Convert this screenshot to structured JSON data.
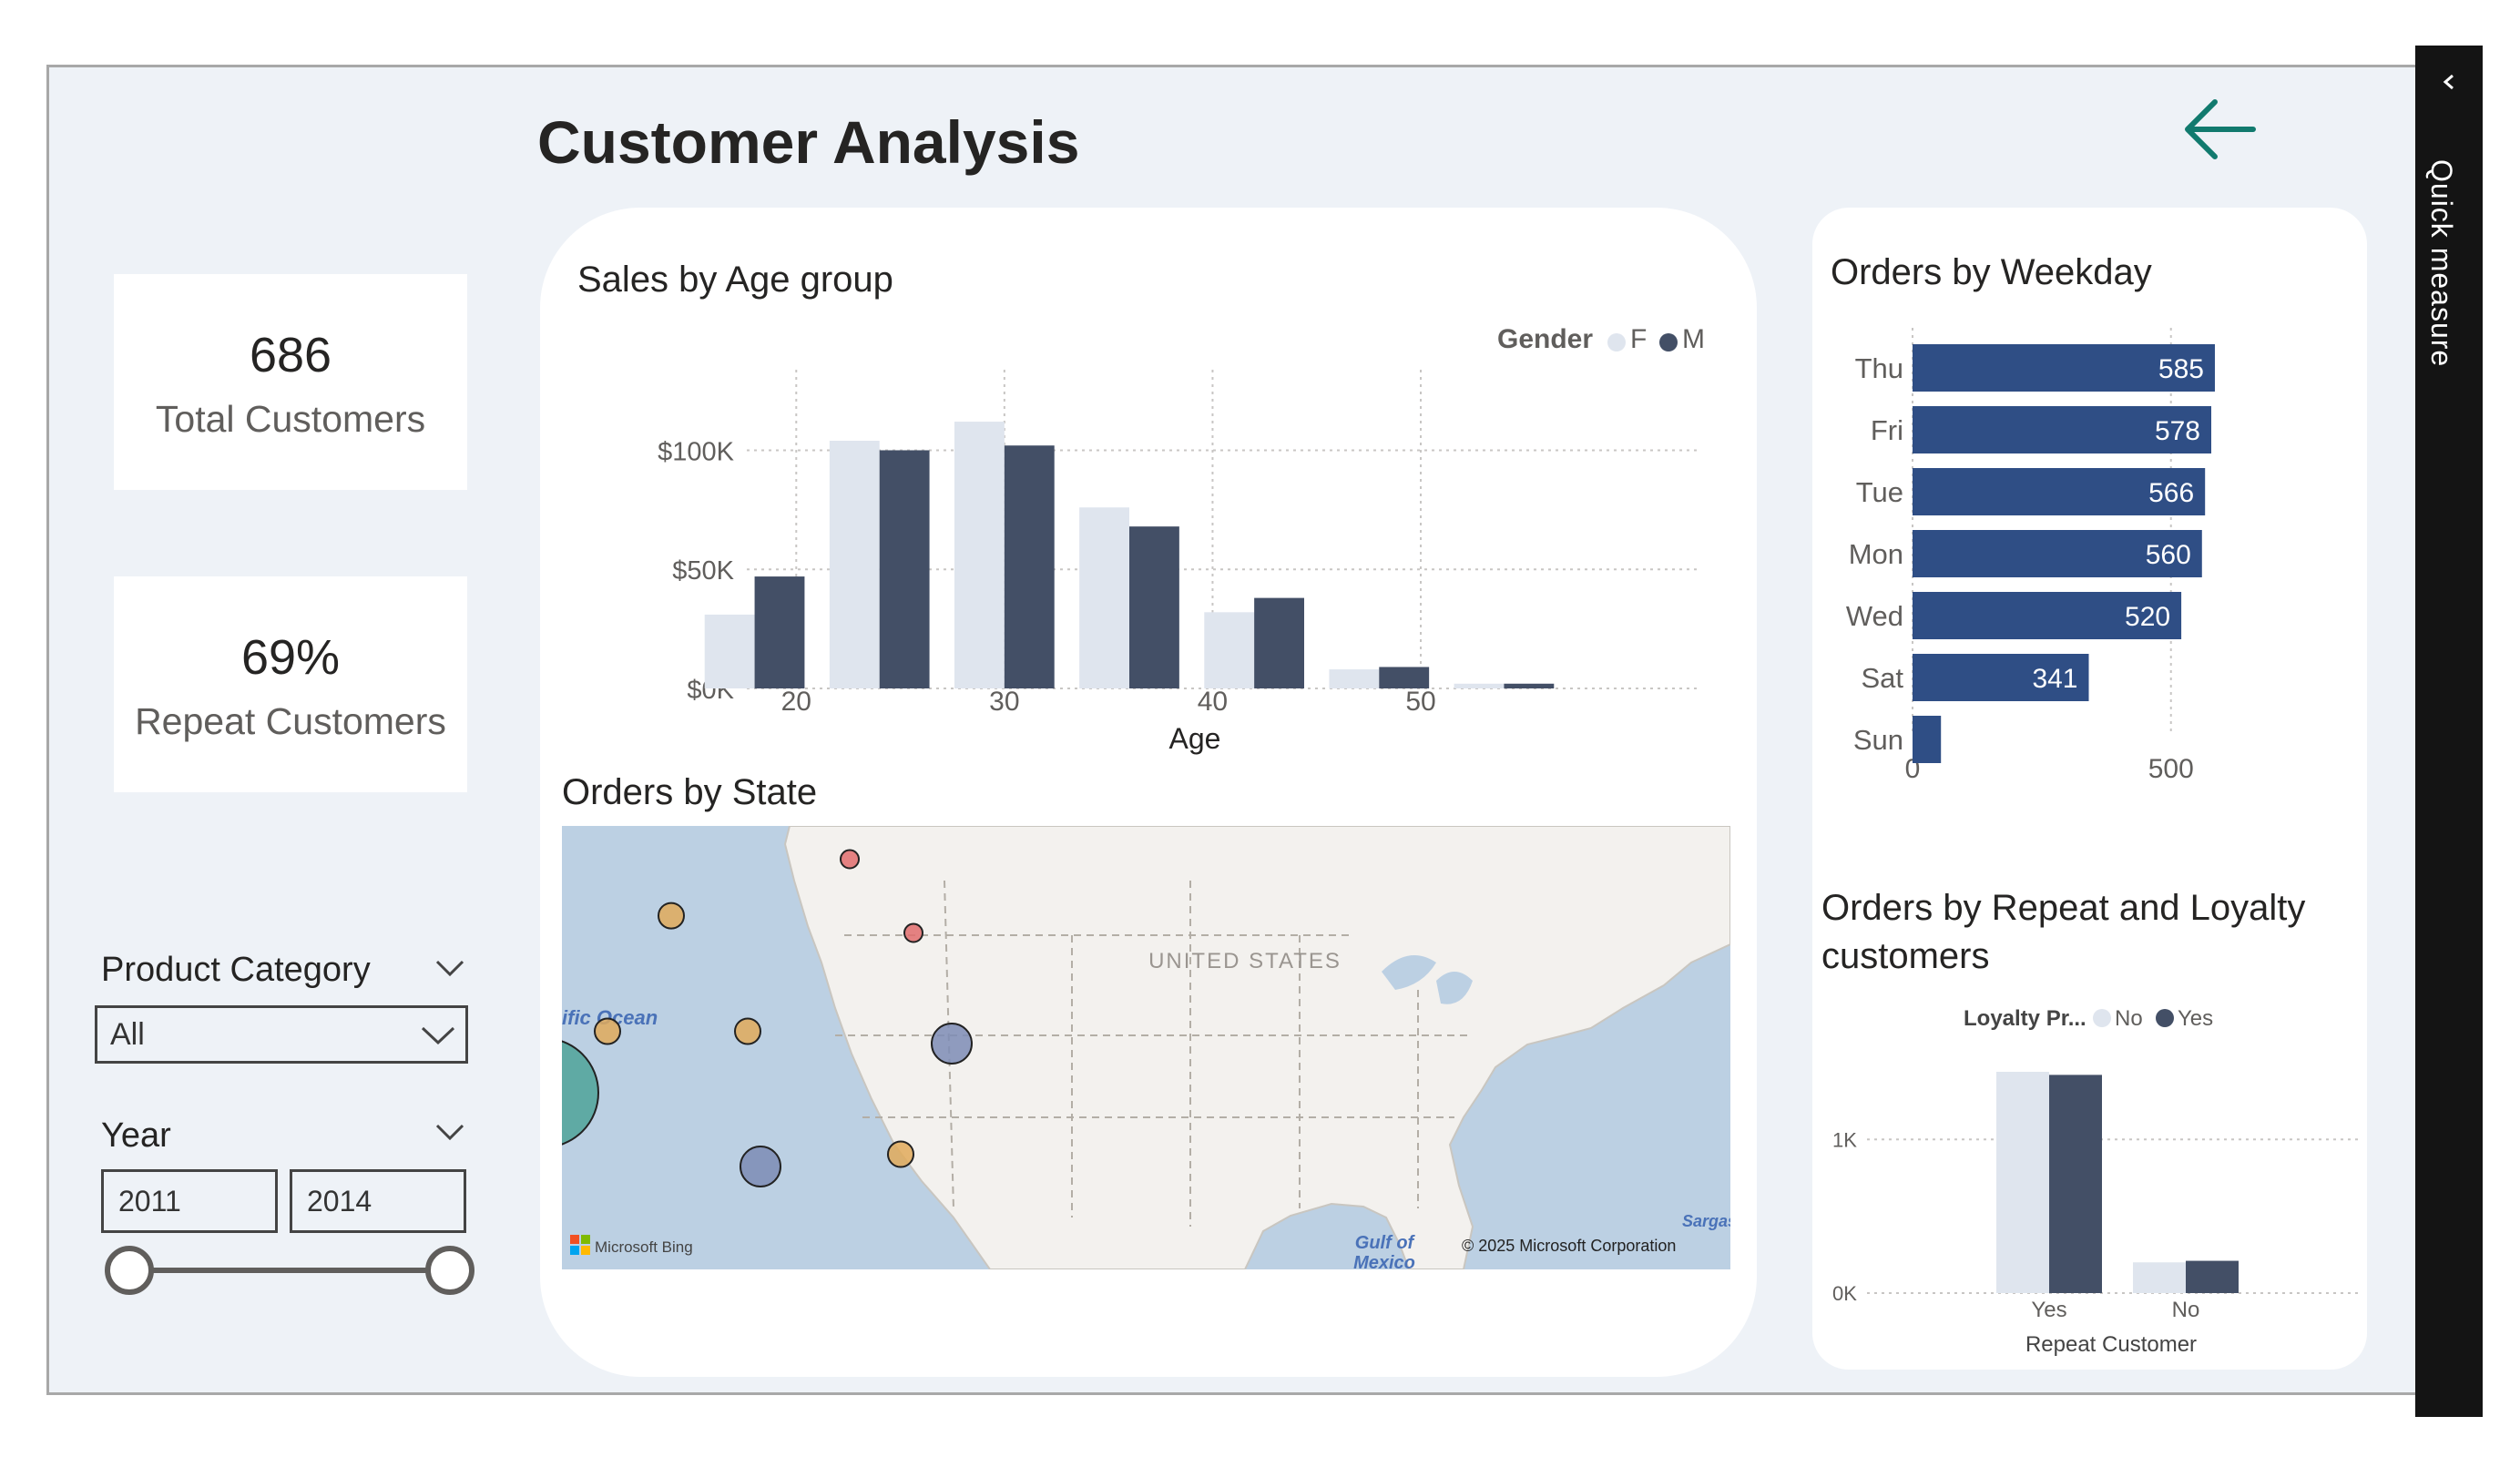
{
  "page": {
    "title": "Customer Analysis",
    "quick_measure": "Quick measure",
    "collapse_icon": "chevron-left-icon",
    "back_icon": "arrow-left-icon"
  },
  "cards": {
    "total_customers": {
      "value": "686",
      "label": "Total Customers"
    },
    "repeat_customers": {
      "value": "69%",
      "label": "Repeat Customers"
    }
  },
  "slicers": {
    "product_category": {
      "label": "Product Category",
      "selected": "All"
    },
    "year": {
      "label": "Year",
      "from": "2011",
      "to": "2014",
      "range_fraction": [
        0,
        1
      ]
    }
  },
  "visuals": {
    "sales_by_age": {
      "title": "Sales by Age group",
      "legend_title": "Gender"
    },
    "orders_by_state": {
      "title": "Orders by State",
      "labels": {
        "ocean": "ific Ocean",
        "country": "UNITED STATES",
        "gulf_line1": "Gulf of",
        "gulf_line2": "Mexico",
        "sargasso": "Sargasso",
        "bing": "Microsoft Bing",
        "copyright": "© 2025 Microsoft Corporation"
      },
      "bubbles": [
        {
          "lon": -123.0,
          "lat": 44.0,
          "size": "large",
          "color": "#4fa399"
        },
        {
          "lon": -120.0,
          "lat": 37.0,
          "size": "xlarge",
          "color": "#4fa399"
        },
        {
          "lon": -120.5,
          "lat": 47.3,
          "size": "medium",
          "color": "#7c8cb5"
        },
        {
          "lon": -115.0,
          "lat": 44.2,
          "size": "small",
          "color": "#e0aa5a"
        },
        {
          "lon": -108.0,
          "lat": 46.5,
          "size": "xsmall",
          "color": "#e06d6d"
        },
        {
          "lon": -105.5,
          "lat": 43.5,
          "size": "xsmall",
          "color": "#e06d6d"
        },
        {
          "lon": -117.5,
          "lat": 39.5,
          "size": "small",
          "color": "#e0aa5a"
        },
        {
          "lon": -112.0,
          "lat": 39.5,
          "size": "small",
          "color": "#e0aa5a"
        },
        {
          "lon": -104.0,
          "lat": 39.0,
          "size": "medium",
          "color": "#7c8cb5"
        },
        {
          "lon": -111.5,
          "lat": 34.0,
          "size": "medium",
          "color": "#7c8cb5"
        },
        {
          "lon": -106.0,
          "lat": 34.5,
          "size": "small",
          "color": "#e0aa5a"
        }
      ]
    },
    "orders_by_weekday": {
      "title": "Orders by Weekday"
    },
    "repeat_loyalty": {
      "title_line1": "Orders by Repeat and Loyalty",
      "title_line2": "customers",
      "legend_title": "Loyalty Pr..."
    }
  },
  "chart_data": [
    {
      "type": "bar",
      "title": "Sales by Age group",
      "xlabel": "Age",
      "ylabel": "",
      "x_ticks": [
        20,
        30,
        40,
        50
      ],
      "y_ticks": [
        "$0K",
        "$50K",
        "$100K"
      ],
      "ylim": [
        0,
        130000
      ],
      "xlim": [
        15,
        57
      ],
      "legend_title": "Gender",
      "legend_position": "top-right",
      "grid": true,
      "bin_width": 6,
      "x": [
        18,
        24,
        30,
        36,
        42,
        48,
        54
      ],
      "series": [
        {
          "name": "F",
          "color": "#dfe5ee",
          "values": [
            31000,
            104000,
            112000,
            76000,
            32000,
            8000,
            2000
          ]
        },
        {
          "name": "M",
          "color": "#434f66",
          "values": [
            47000,
            100000,
            102000,
            68000,
            38000,
            9000,
            2000
          ]
        }
      ]
    },
    {
      "type": "bar",
      "orientation": "horizontal",
      "title": "Orders by Weekday",
      "categories": [
        "Thu",
        "Fri",
        "Tue",
        "Mon",
        "Wed",
        "Sat",
        "Sun"
      ],
      "values": [
        585,
        578,
        566,
        560,
        520,
        341,
        55
      ],
      "data_labels": [
        "585",
        "578",
        "566",
        "560",
        "520",
        "341",
        ""
      ],
      "x_ticks": [
        0,
        500
      ],
      "xlim": [
        0,
        615
      ],
      "grid": true,
      "color": "#2f4e85"
    },
    {
      "type": "bar",
      "title": "Orders by Repeat and Loyalty customers",
      "xlabel": "Repeat Customer",
      "categories": [
        "Yes",
        "No"
      ],
      "y_ticks": [
        "0K",
        "1K"
      ],
      "ylim": [
        0,
        1600
      ],
      "legend_title": "Loyalty Pr...",
      "legend_position": "top-center",
      "grid": true,
      "series": [
        {
          "name": "No",
          "color": "#dfe5ee",
          "values": [
            1440,
            200
          ]
        },
        {
          "name": "Yes",
          "color": "#434f66",
          "values": [
            1420,
            210
          ]
        }
      ]
    }
  ]
}
